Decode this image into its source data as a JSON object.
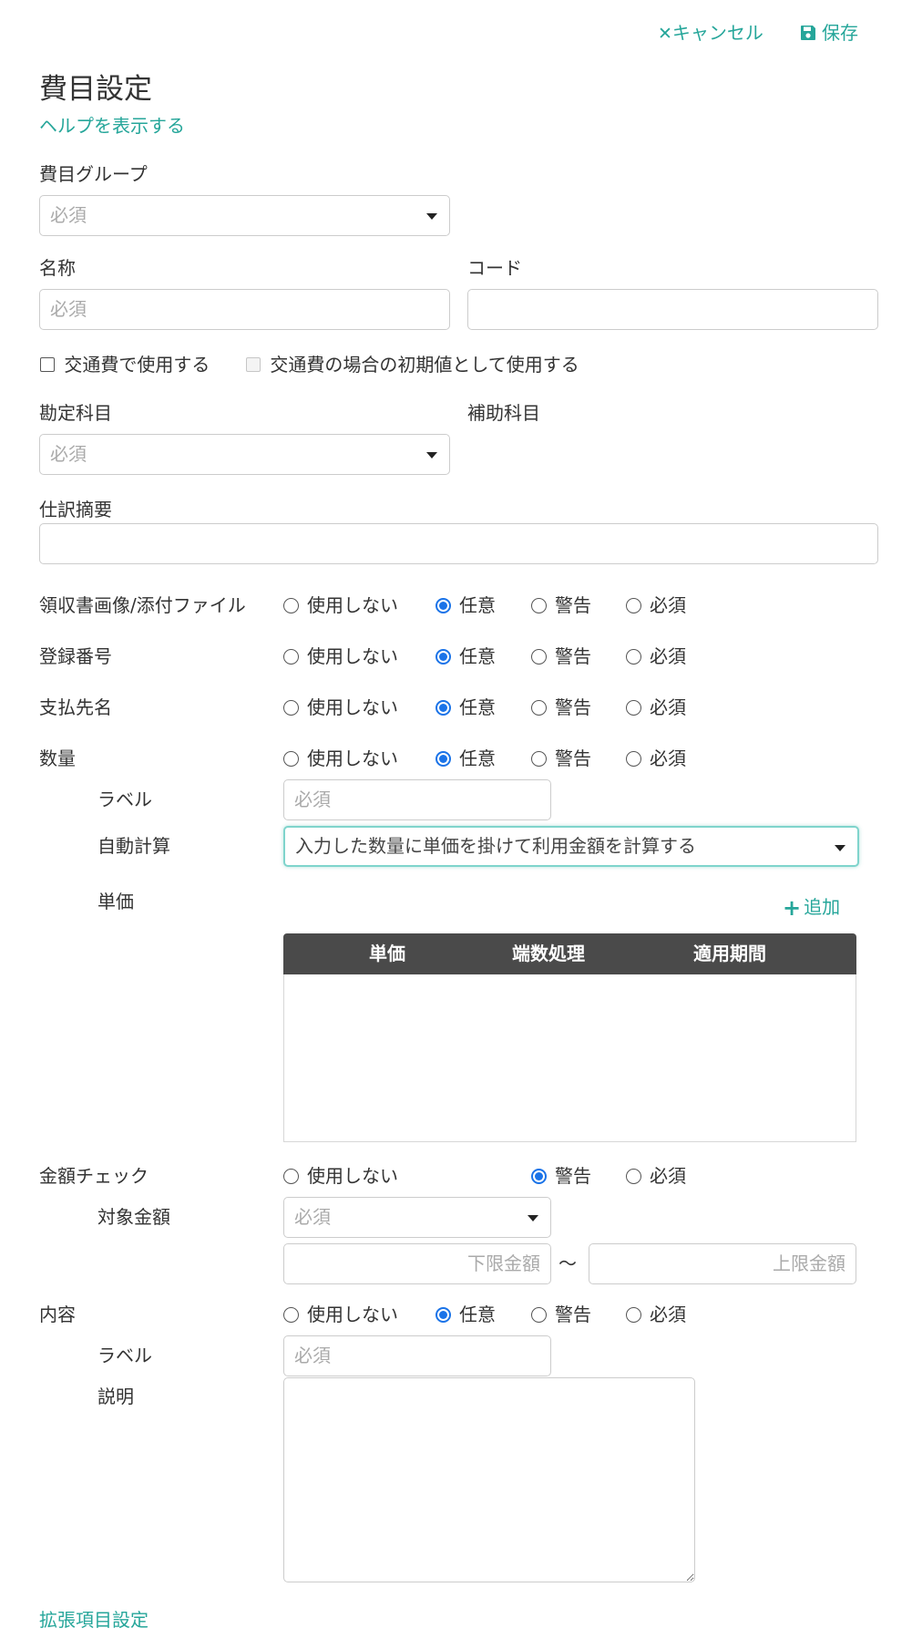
{
  "toolbar": {
    "cancel_label": "キャンセル",
    "save_label": "保存"
  },
  "page": {
    "title": "費目設定",
    "help_link": "ヘルプを表示する",
    "extension_link": "拡張項目設定"
  },
  "fields": {
    "expense_group": {
      "label": "費目グループ",
      "placeholder": "必須"
    },
    "name": {
      "label": "名称",
      "placeholder": "必須"
    },
    "code": {
      "label": "コード",
      "value": ""
    },
    "use_as_transport": {
      "label": "交通費で使用する",
      "checked": false
    },
    "transport_default": {
      "label": "交通費の場合の初期値として使用する",
      "checked": false,
      "disabled": true
    },
    "account": {
      "label": "勘定科目",
      "placeholder": "必須"
    },
    "sub_account": {
      "label": "補助科目"
    },
    "journal_summary": {
      "label": "仕訳摘要",
      "value": ""
    }
  },
  "radio_options": {
    "none": "使用しない",
    "optional": "任意",
    "warning": "警告",
    "required": "必須"
  },
  "radio_rows": {
    "receipt": {
      "label": "領収書画像/添付ファイル",
      "selected": "optional"
    },
    "registration_number": {
      "label": "登録番号",
      "selected": "optional"
    },
    "payee": {
      "label": "支払先名",
      "selected": "optional"
    },
    "quantity": {
      "label": "数量",
      "selected": "optional"
    },
    "amount_check": {
      "label": "金額チェック",
      "selected": "warning"
    },
    "content": {
      "label": "内容",
      "selected": "optional"
    }
  },
  "quantity": {
    "label_label": "ラベル",
    "label_placeholder": "必須",
    "auto_calc_label": "自動計算",
    "auto_calc_value": "入力した数量に単価を掛けて利用金額を計算する",
    "unit_price_label": "単価",
    "add_label": "追加",
    "grid_columns": [
      "単価",
      "端数処理",
      "適用期間"
    ],
    "grid_rows": []
  },
  "amount_check": {
    "target_label": "対象金額",
    "target_placeholder": "必須",
    "lower_placeholder": "下限金額",
    "range_sep": "〜",
    "upper_placeholder": "上限金額"
  },
  "content": {
    "label_label": "ラベル",
    "label_placeholder": "必須",
    "description_label": "説明",
    "description_value": ""
  },
  "colors": {
    "accent": "#26a69a",
    "radio_selected": "#1a73e8",
    "grid_header": "#4a4a4a"
  }
}
